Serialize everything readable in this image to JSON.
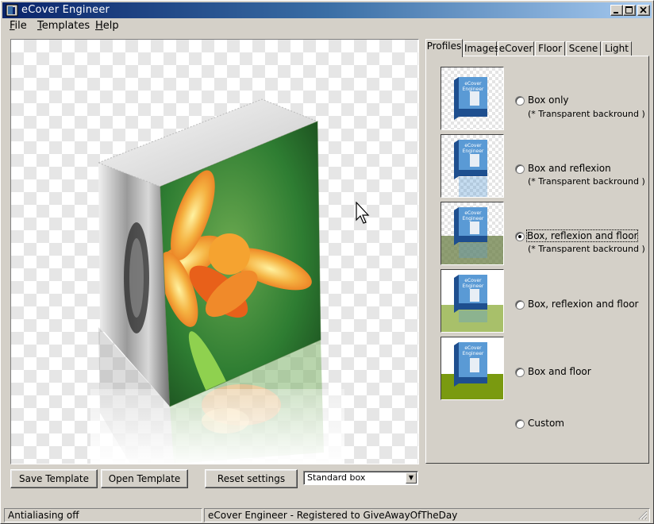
{
  "window": {
    "title": "eCover Engineer"
  },
  "menu": [
    {
      "prefix": "",
      "accel": "F",
      "rest": "ile"
    },
    {
      "prefix": "",
      "accel": "T",
      "rest": "emplates"
    },
    {
      "prefix": "",
      "accel": "H",
      "rest": "elp"
    }
  ],
  "tabs": [
    "Profiles",
    "Images",
    "eCover",
    "Floor",
    "Scene",
    "Light"
  ],
  "active_tab": "Profiles",
  "profiles": [
    {
      "label": "Box only",
      "sub": "(* Transparent backround )",
      "selected": false
    },
    {
      "label": "Box and reflexion",
      "sub": "(* Transparent backround )",
      "selected": false
    },
    {
      "label": "Box, reflexion and floor",
      "sub": "(* Transparent backround )",
      "selected": true
    },
    {
      "label": "Box, reflexion and floor",
      "sub": "",
      "selected": false
    },
    {
      "label": "Box and floor",
      "sub": "",
      "selected": false
    },
    {
      "label": "Custom",
      "sub": "",
      "selected": false
    }
  ],
  "thumb_text": [
    "eCover",
    "Engineer"
  ],
  "buttons": {
    "save_template": "Save Template",
    "open_template": "Open Template",
    "reset_settings": "Reset settings"
  },
  "box_type": {
    "selected": "Standard box"
  },
  "status": {
    "left": "Antialiasing off",
    "right": "eCover Engineer - Registered to GiveAwayOfTheDay"
  },
  "colors": {
    "titlebar_start": "#0a246a",
    "titlebar_end": "#a6caf0",
    "face": "#d4d0c8"
  }
}
